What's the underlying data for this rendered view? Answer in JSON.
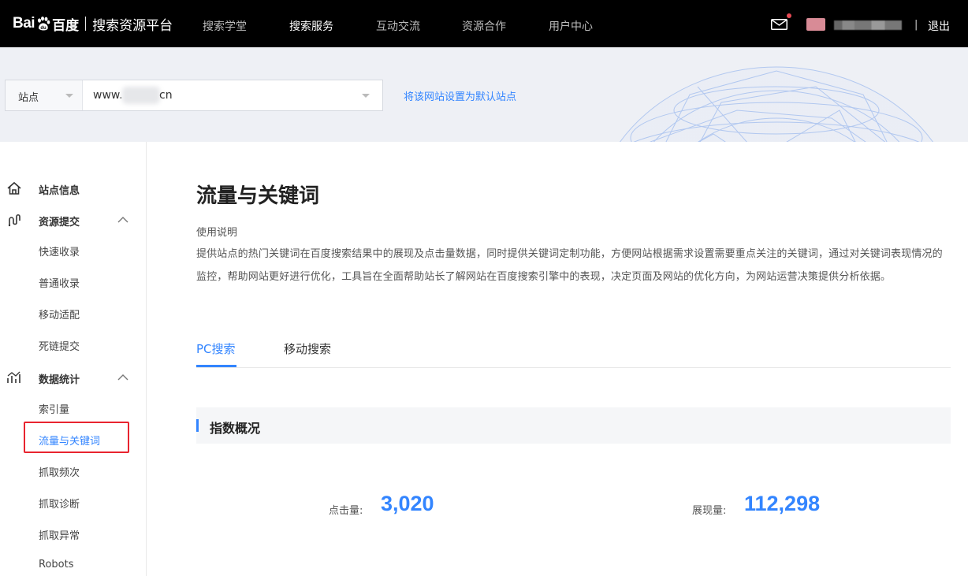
{
  "header": {
    "logo": {
      "bai": "Bai",
      "cn": "百度",
      "platform": "搜索资源平台"
    },
    "nav": [
      {
        "label": "搜索学堂",
        "active": false
      },
      {
        "label": "搜索服务",
        "active": true
      },
      {
        "label": "互动交流",
        "active": false
      },
      {
        "label": "资源合作",
        "active": false
      },
      {
        "label": "用户中心",
        "active": false
      }
    ],
    "separator": "|",
    "logout_label": "退出"
  },
  "site_bar": {
    "type_label": "站点",
    "site_prefix": "www.",
    "site_suffix": "cn",
    "set_default_label": "将该网站设置为默认站点"
  },
  "sidebar": {
    "groups": [
      {
        "label": "站点信息",
        "icon": "home-icon",
        "items": []
      },
      {
        "label": "资源提交",
        "icon": "submit-icon",
        "items": [
          "快速收录",
          "普通收录",
          "移动适配",
          "死链提交"
        ]
      },
      {
        "label": "数据统计",
        "icon": "stats-icon",
        "items": [
          "索引量",
          "流量与关键词",
          "抓取频次",
          "抓取诊断",
          "抓取异常",
          "Robots"
        ]
      }
    ],
    "active_item": "流量与关键词"
  },
  "main": {
    "title": "流量与关键词",
    "desc_heading": "使用说明",
    "desc_body": "提供站点的热门关键词在百度搜索结果中的展现及点击量数据，同时提供关键词定制功能，方便网站根据需求设置需要重点关注的关键词，通过对关键词表现情况的监控，帮助网站更好进行优化，工具旨在全面帮助站长了解网站在百度搜索引擎中的表现，决定页面及网站的优化方向，为网站运营决策提供分析依据。",
    "tabs": [
      {
        "label": "PC搜索",
        "active": true
      },
      {
        "label": "移动搜索",
        "active": false
      }
    ],
    "section_title": "指数概况",
    "metrics": [
      {
        "label": "点击量:",
        "value": "3,020"
      },
      {
        "label": "展现量:",
        "value": "112,298"
      }
    ]
  },
  "colors": {
    "accent": "#3385ff",
    "highlight_box": "#e8242f",
    "topbar": "#000000"
  }
}
